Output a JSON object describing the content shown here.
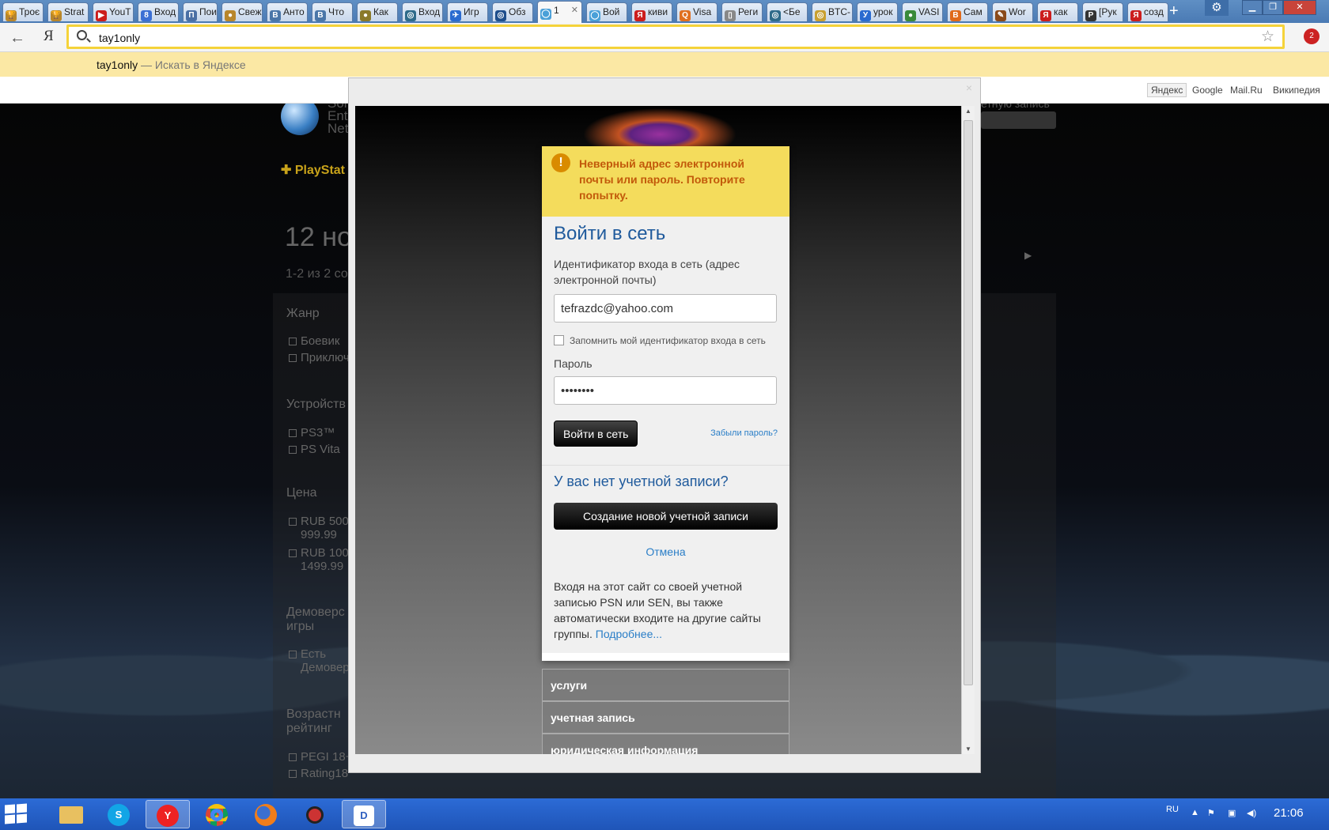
{
  "tabs": [
    {
      "label": "Троє",
      "color": "#b8862b",
      "glyph": "🏆"
    },
    {
      "label": "Strat",
      "color": "#b8862b",
      "glyph": "🏆"
    },
    {
      "label": "YouT",
      "color": "#cc1d1d",
      "glyph": "▶"
    },
    {
      "label": "Вход",
      "color": "#3b6fd4",
      "glyph": "8"
    },
    {
      "label": "Пои",
      "color": "#4a6fa5",
      "glyph": "П"
    },
    {
      "label": "Свеж",
      "color": "#b8862b",
      "glyph": "●"
    },
    {
      "label": "Анто",
      "color": "#4a76a8",
      "glyph": "В"
    },
    {
      "label": "Что",
      "color": "#4a76a8",
      "glyph": "В"
    },
    {
      "label": "Как",
      "color": "#8a7a2a",
      "glyph": "●"
    },
    {
      "label": "Вход",
      "color": "#2e6b8a",
      "glyph": "◎"
    },
    {
      "label": "Игр",
      "color": "#2a6bd0",
      "glyph": "✈"
    },
    {
      "label": "Обз",
      "color": "#1e4e8c",
      "glyph": "◎"
    },
    {
      "label": "1",
      "color": "#4aa0d8",
      "glyph": "◯"
    },
    {
      "label": "Вой",
      "color": "#4aa0d8",
      "glyph": "◯"
    },
    {
      "label": "киви",
      "color": "#cc1d1d",
      "glyph": "Я"
    },
    {
      "label": "Visa",
      "color": "#e07020",
      "glyph": "Q"
    },
    {
      "label": "Реги",
      "color": "#888888",
      "glyph": "▯"
    },
    {
      "label": "<Бе",
      "color": "#2e6b8a",
      "glyph": "◎"
    },
    {
      "label": "BTC-",
      "color": "#c9a030",
      "glyph": "◎"
    },
    {
      "label": "урок",
      "color": "#2a6bd0",
      "glyph": "У"
    },
    {
      "label": "VASI",
      "color": "#3a8a3a",
      "glyph": "●"
    },
    {
      "label": "Сам",
      "color": "#e06a1a",
      "glyph": "B"
    },
    {
      "label": "Wor",
      "color": "#8a4a1a",
      "glyph": "✎"
    },
    {
      "label": "как",
      "color": "#cc1d1d",
      "glyph": "Я"
    },
    {
      "label": "[Рук",
      "color": "#333333",
      "glyph": "P"
    },
    {
      "label": "созд",
      "color": "#cc1d1d",
      "glyph": "Я"
    }
  ],
  "omnibox": {
    "value": "tay1only",
    "nav_back": "←",
    "yandex_logo": "Я",
    "star": "☆"
  },
  "extension_badge": "2",
  "suggestion": {
    "query": "tay1only",
    "hint": " — Искать в Яндексе"
  },
  "bookmarks": [
    "Яндекс",
    "Google",
    "Mail.Ru",
    "Википедия"
  ],
  "background_page": {
    "logo_lines": [
      "Son",
      "Ent",
      "Net"
    ],
    "plus_label": "PlayStat",
    "account_link": "етную запись",
    "heading": "12 но",
    "count": "1-2 из 2 со",
    "genre_title": "Жанр",
    "genres": [
      "Боевик",
      "Приключ"
    ],
    "devices_title": "Устройств",
    "devices": [
      "PS3™",
      "PS Vita"
    ],
    "price_title": "Цена",
    "prices": [
      "RUB 500 -",
      "999.99",
      "RUB 1000",
      "1499.99"
    ],
    "demo_title": [
      "Демоверс",
      "игры"
    ],
    "demo_opts": [
      "Есть",
      "Демовер"
    ],
    "age_title": [
      "Возрастн",
      "рейтинг"
    ],
    "ages": [
      "PEGI 18+",
      "Rating18"
    ]
  },
  "dialog": {
    "close_glyph": "×",
    "error_icon": "!",
    "error": "Неверный адрес электронной почты или пароль. Повторите попытку.",
    "title": "Войти в сеть",
    "id_label": "Идентификатор входа в сеть (адрес электронной почты)",
    "email_value": "tefrazdc@yahoo.com",
    "remember": "Запомнить мой идентификатор входа в сеть",
    "password_label": "Пароль",
    "password_value": "••••••••",
    "login_button": "Войти в сеть",
    "forgot": "Забыли пароль?",
    "no_account": "У вас нет учетной записи?",
    "create_button": "Создание новой учетной записи",
    "cancel": "Отмена",
    "info": "Входя на этот сайт со своей учетной записью PSN или SEN, вы также автоматически входите на другие сайты группы. ",
    "more": "Подробнее...",
    "footer_links": [
      "услуги",
      "учетная запись",
      "юридическая информация"
    ]
  },
  "taskbar": {
    "apps": [
      "file-explorer",
      "skype",
      "yandex-browser",
      "chrome",
      "firefox",
      "media-app",
      "app"
    ],
    "lang": "RU",
    "time": "21:06"
  }
}
